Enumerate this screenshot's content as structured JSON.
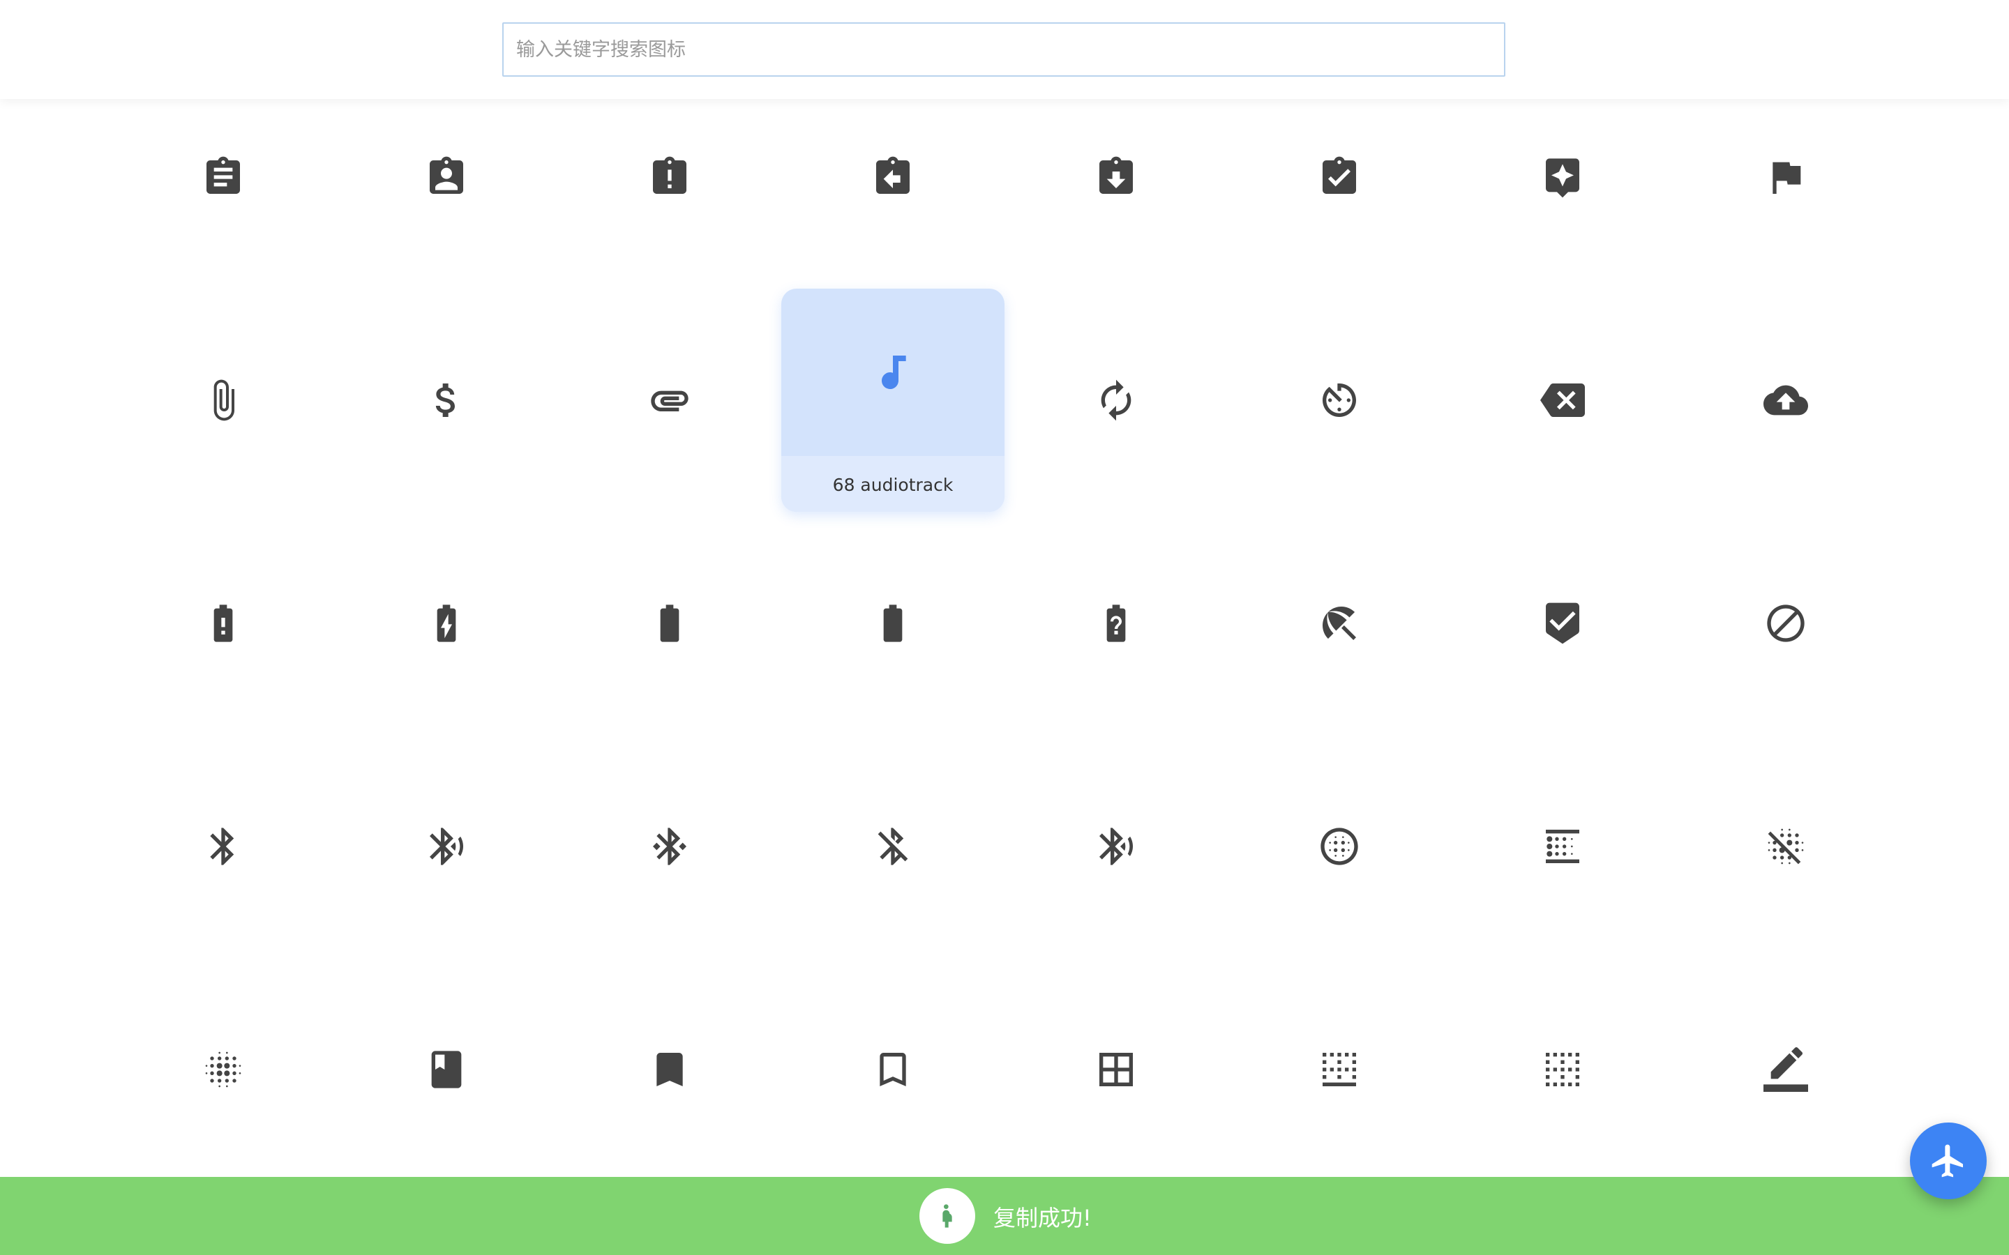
{
  "search": {
    "placeholder": "输入关键字搜索图标",
    "value": ""
  },
  "selected": {
    "index": 11,
    "label": "68 audiotrack"
  },
  "icons": [
    {
      "name": "assignment-icon"
    },
    {
      "name": "assignment-ind-icon"
    },
    {
      "name": "assignment-late-icon"
    },
    {
      "name": "assignment-return-icon"
    },
    {
      "name": "assignment-returned-icon"
    },
    {
      "name": "assignment-turned-in-icon"
    },
    {
      "name": "assistant-icon"
    },
    {
      "name": "assistant-photo-icon"
    },
    {
      "name": "attach-file-icon"
    },
    {
      "name": "attach-money-icon"
    },
    {
      "name": "attachment-icon"
    },
    {
      "name": "audiotrack-icon",
      "label": "68 audiotrack"
    },
    {
      "name": "autorenew-icon"
    },
    {
      "name": "av-timer-icon"
    },
    {
      "name": "backspace-icon"
    },
    {
      "name": "backup-icon"
    },
    {
      "name": "battery-alert-icon"
    },
    {
      "name": "battery-charging-full-icon"
    },
    {
      "name": "battery-full-icon"
    },
    {
      "name": "battery-std-icon"
    },
    {
      "name": "battery-unknown-icon"
    },
    {
      "name": "beach-access-icon"
    },
    {
      "name": "beenhere-icon"
    },
    {
      "name": "block-icon"
    },
    {
      "name": "bluetooth-icon"
    },
    {
      "name": "bluetooth-audio-icon"
    },
    {
      "name": "bluetooth-connected-icon"
    },
    {
      "name": "bluetooth-disabled-icon"
    },
    {
      "name": "bluetooth-searching-icon"
    },
    {
      "name": "blur-circular-icon"
    },
    {
      "name": "blur-linear-icon"
    },
    {
      "name": "blur-off-icon"
    },
    {
      "name": "blur-on-icon"
    },
    {
      "name": "book-icon"
    },
    {
      "name": "bookmark-icon"
    },
    {
      "name": "bookmark-border-icon"
    },
    {
      "name": "border-all-icon"
    },
    {
      "name": "border-bottom-icon"
    },
    {
      "name": "border-clear-icon"
    },
    {
      "name": "border-color-icon"
    }
  ],
  "toast": {
    "message": "复制成功!",
    "icon": "pregnant-woman-icon",
    "color": "#80d470"
  },
  "fab": {
    "icon": "airplane-icon",
    "color": "#3d84f4"
  },
  "colors": {
    "icon": "#444444",
    "selected_bg": "#d3e3fc",
    "selected_icon": "#4a86ee"
  }
}
